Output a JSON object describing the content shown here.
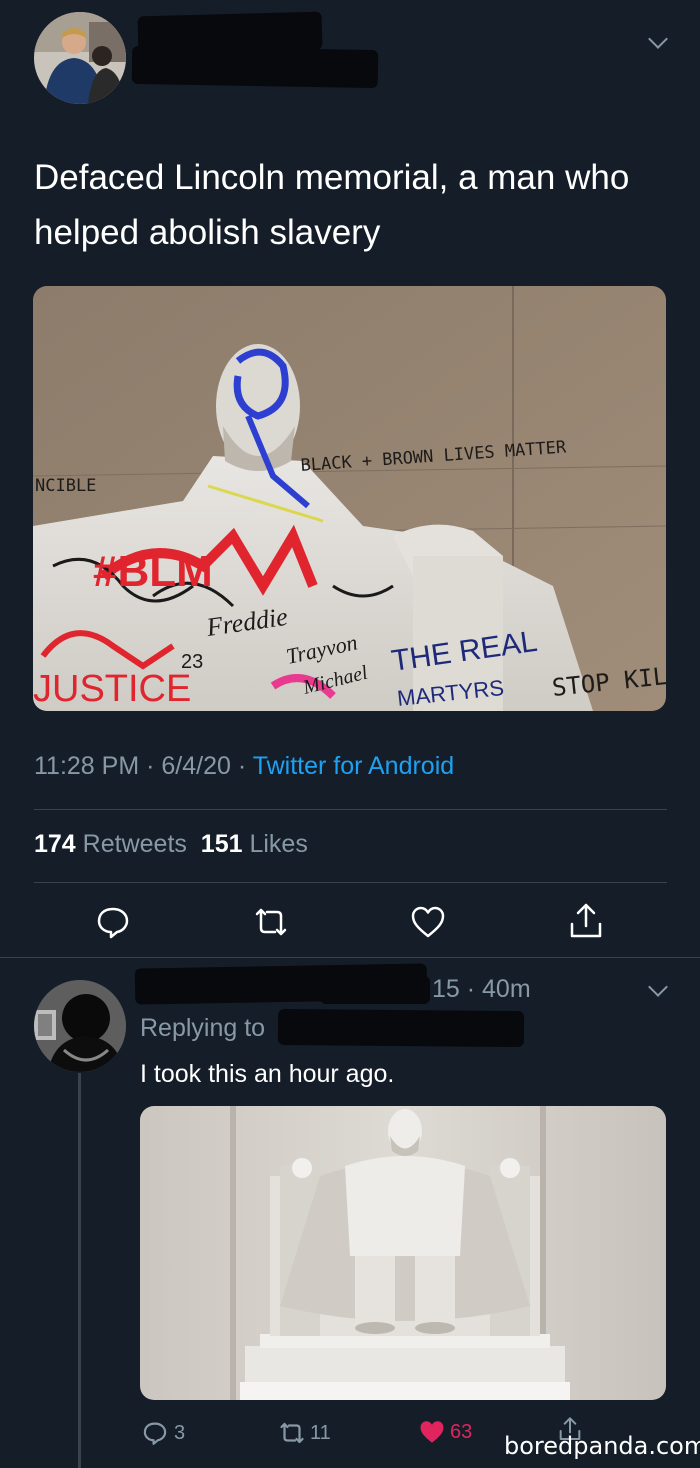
{
  "tweet": {
    "text": "Defaced Lincoln memorial, a man who helped abolish slavery",
    "time": "11:28 PM",
    "date": "6/4/20",
    "separator": "·",
    "source": "Twitter for Android",
    "retweets_count": "174",
    "retweets_label": "Retweets",
    "likes_count": "151",
    "likes_label": "Likes",
    "image_graffiti": {
      "incible": "NCIBLE",
      "blm_line": "BLACK + BROWN LIVES MATTER",
      "blm": "#BLM",
      "freddie": "Freddie",
      "trayvon": "Trayvon",
      "michael": "Michael",
      "the_real": "THE REAL",
      "martyrs": "MARTYRS",
      "stop_kill": "STOP KIL",
      "justice": "JUSTICE",
      "num": "23"
    }
  },
  "reply": {
    "time_suffix": "15 · 40m",
    "replying_to": "Replying to",
    "text": "I took this an hour ago.",
    "reply_count": "3",
    "retweet_count": "11",
    "like_count": "63"
  },
  "watermark": "boredpanda.com",
  "colors": {
    "background": "#151d29",
    "secondary_text": "#8899a6",
    "link": "#1da1f2",
    "liked": "#e0245e",
    "divider": "#38444d"
  },
  "icons": {
    "menu": "chevron-down-icon",
    "reply": "reply-bubble-icon",
    "retweet": "retweet-icon",
    "like": "heart-icon",
    "share": "share-icon"
  }
}
